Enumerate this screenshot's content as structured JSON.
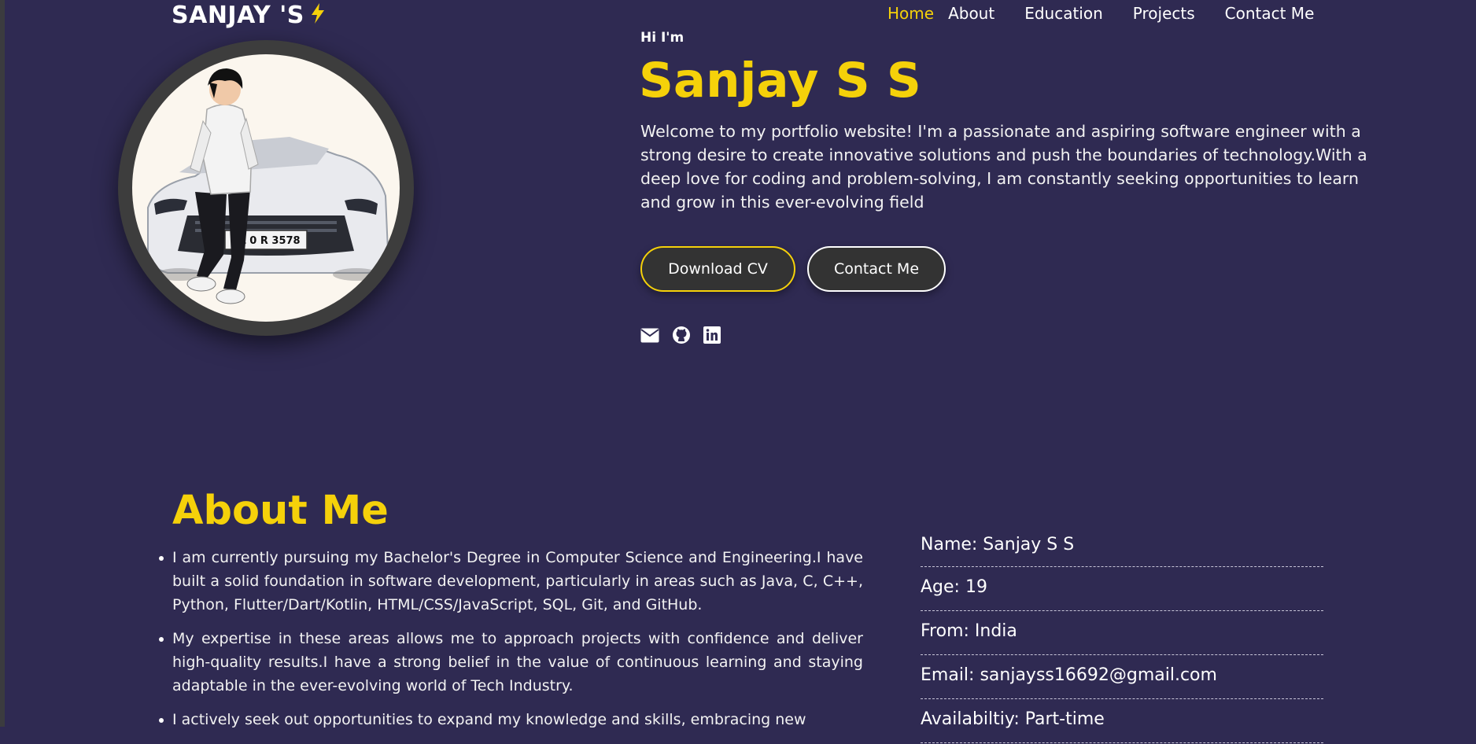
{
  "header": {
    "brand": "SANJAY 'S",
    "brand_icon": "bolt-icon",
    "nav": [
      {
        "label": "Home",
        "active": true
      },
      {
        "label": "About"
      },
      {
        "label": "Education"
      },
      {
        "label": "Projects"
      },
      {
        "label": "Contact Me"
      }
    ]
  },
  "hero": {
    "greeting": "Hi I'm",
    "name": "Sanjay S S",
    "description": "Welcome to my portfolio website! I'm a passionate and aspiring software engineer with a strong desire to create innovative solutions and push the boundaries of technology.With a deep love for coding and problem-solving, I am constantly seeking opportunities to learn and grow in this ever-evolving field",
    "buttons": {
      "download_cv": "Download CV",
      "contact_me": "Contact Me"
    },
    "socials": [
      "envelope-icon",
      "github-icon",
      "linkedin-icon"
    ],
    "avatar": {
      "plate_text": "KL 0 R 3578"
    }
  },
  "about": {
    "title": "About Me",
    "points": [
      "I am currently pursuing my Bachelor's Degree in Computer Science and Engineering.I have built a solid foundation in software development, particularly in areas such as Java, C, C++, Python, Flutter/Dart/Kotlin, HTML/CSS/JavaScript, SQL, Git, and GitHub.",
      "My expertise in these areas allows me to approach projects with confidence and deliver high-quality results.I have a strong belief in the value of continuous learning and staying adaptable in the ever-evolving world of Tech Industry.",
      "I actively seek out opportunities to expand my knowledge and skills, embracing new"
    ],
    "info": [
      "Name: Sanjay S S",
      "Age: 19",
      "From: India",
      "Email: sanjayss16692@gmail.com",
      "Availabiltiy: Part-time"
    ]
  },
  "colors": {
    "background": "#2f2a52",
    "accent": "#f5d10a",
    "button_bg": "#333333"
  }
}
